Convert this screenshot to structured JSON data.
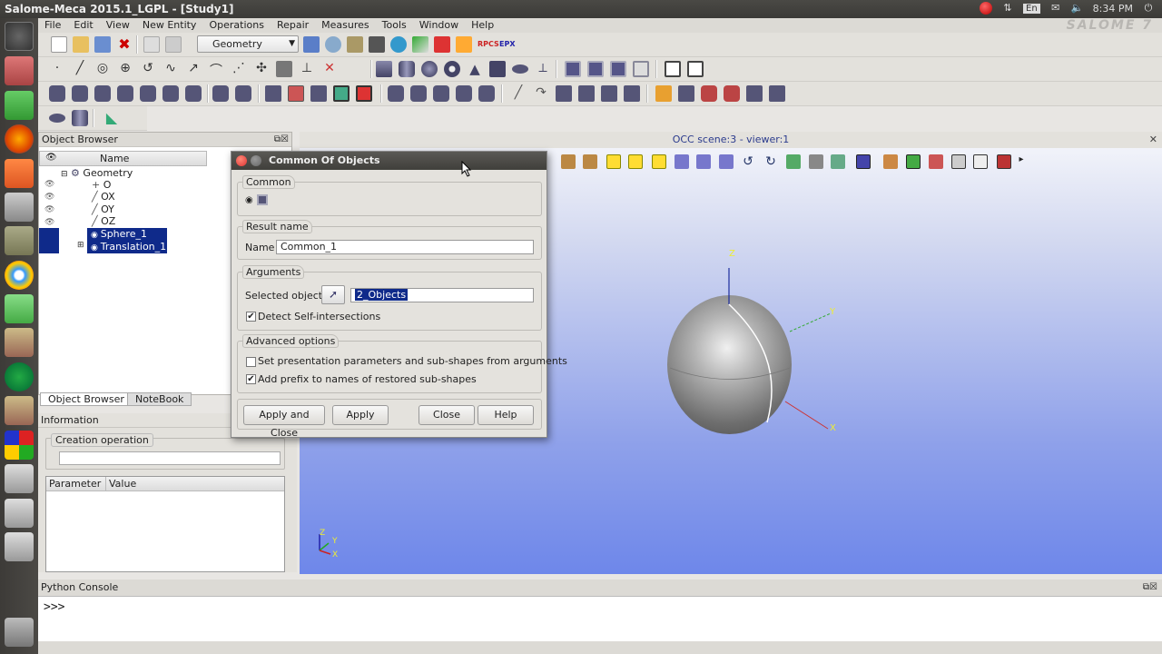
{
  "window": {
    "title": "Salome-Meca 2015.1_LGPL - [Study1]",
    "brand": "SALOME 7"
  },
  "tray": {
    "lang": "En",
    "time": "8:34 PM"
  },
  "menu": [
    "File",
    "Edit",
    "View",
    "New Entity",
    "Operations",
    "Repair",
    "Measures",
    "Tools",
    "Window",
    "Help"
  ],
  "toolbar": {
    "module_combo": "Geometry"
  },
  "object_browser": {
    "title": "Object Browser",
    "column": "Name",
    "root": "Geometry",
    "items": [
      "O",
      "OX",
      "OY",
      "OZ"
    ],
    "selected": [
      "Sphere_1",
      "Translation_1"
    ],
    "tabs": [
      "Object Browser",
      "NoteBook"
    ]
  },
  "information": {
    "title": "Information",
    "group": "Creation operation",
    "table_headers": [
      "Parameter",
      "Value"
    ]
  },
  "viewer": {
    "title": "OCC scene:3 - viewer:1",
    "axes": [
      "Z",
      "Y",
      "X"
    ]
  },
  "console": {
    "title": "Python Console",
    "prompt": ">>>"
  },
  "dialog": {
    "title": "Common Of Objects",
    "common_label": "Common",
    "result_name_label": "Result name",
    "name_label": "Name",
    "name_value": "Common_1",
    "arguments_label": "Arguments",
    "selected_objects_label": "Selected objects",
    "selected_objects_value": "2_Objects",
    "detect_self": "Detect Self-intersections",
    "advanced_label": "Advanced options",
    "set_presentation": "Set presentation parameters and sub-shapes from arguments",
    "add_prefix": "Add prefix to names of restored sub-shapes",
    "buttons": {
      "apply_close": "Apply and Close",
      "apply": "Apply",
      "close": "Close",
      "help": "Help"
    }
  },
  "colors": {
    "selection": "#0f2a8a",
    "viewer_top": "#f6f7fb",
    "viewer_bottom": "#6e87ea",
    "accent": "#e95420"
  }
}
